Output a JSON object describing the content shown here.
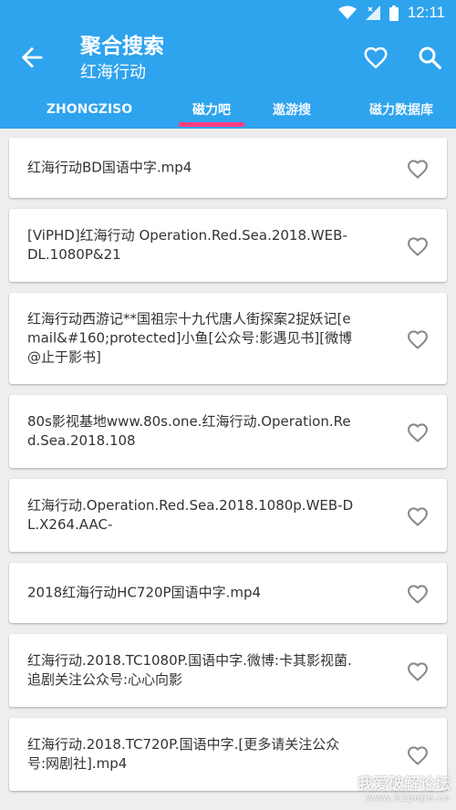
{
  "status_bar": {
    "time": "12:11"
  },
  "header": {
    "title": "聚合搜索",
    "subtitle": "红海行动"
  },
  "tabs": [
    {
      "label": "ZHONGZISO"
    },
    {
      "label": "磁力吧"
    },
    {
      "label": "遨游搜"
    },
    {
      "label": "磁力数据库"
    }
  ],
  "active_tab": 1,
  "results": [
    {
      "text": "红海行动BD国语中字.mp4"
    },
    {
      "text": "[ViPHD]红海行动 Operation.Red.Sea.2018.WEB-DL.1080P&21"
    },
    {
      "text": "红海行动西游记**国祖宗十九代唐人街探案2捉妖记[email&#160;protected]小鱼[公众号:影遇见书][微博@止于影书]"
    },
    {
      "text": "80s影视基地www.80s.one.红海行动.Operation.Red.Sea.2018.108"
    },
    {
      "text": "红海行动.Operation.Red.Sea.2018.1080p.WEB-DL.X264.AAC-"
    },
    {
      "text": "2018红海行动HC720P国语中字.mp4"
    },
    {
      "text": "红海行动.2018.TC1080P.国语中字.微博:卡其影视菌.追剧关注公众号:心心向影"
    },
    {
      "text": "红海行动.2018.TC720P.国语中字.[更多请关注公众号:网剧社].mp4"
    }
  ],
  "watermark": {
    "line1": "我爱破解论坛",
    "line2": "www.52pojie.cn"
  },
  "colors": {
    "primary": "#2ea3ee",
    "indicator": "#ff3d82",
    "background": "#eeeeee"
  }
}
